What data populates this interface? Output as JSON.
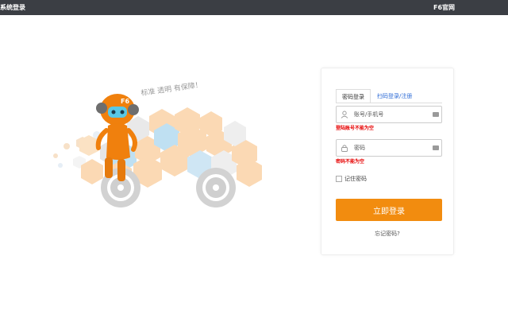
{
  "header": {
    "title": "系统登录",
    "site_link": "F6官网"
  },
  "illustration": {
    "slogan": "标准 透明 有保障！",
    "badge": "F6"
  },
  "login": {
    "tabs": [
      {
        "label": "密码登录",
        "active": true
      },
      {
        "label": "扫码登录/注册",
        "active": false
      }
    ],
    "account_placeholder": "账号/手机号",
    "account_error": "登陆账号不能为空",
    "password_placeholder": "密码",
    "password_error": "密码不能为空",
    "remember_label": "记住密码",
    "submit_label": "立即登录",
    "forgot_label": "忘记密码?"
  },
  "colors": {
    "topbar": "#3b3e44",
    "accent": "#f28c0f",
    "link": "#2d6bd6",
    "error": "#e60000"
  }
}
